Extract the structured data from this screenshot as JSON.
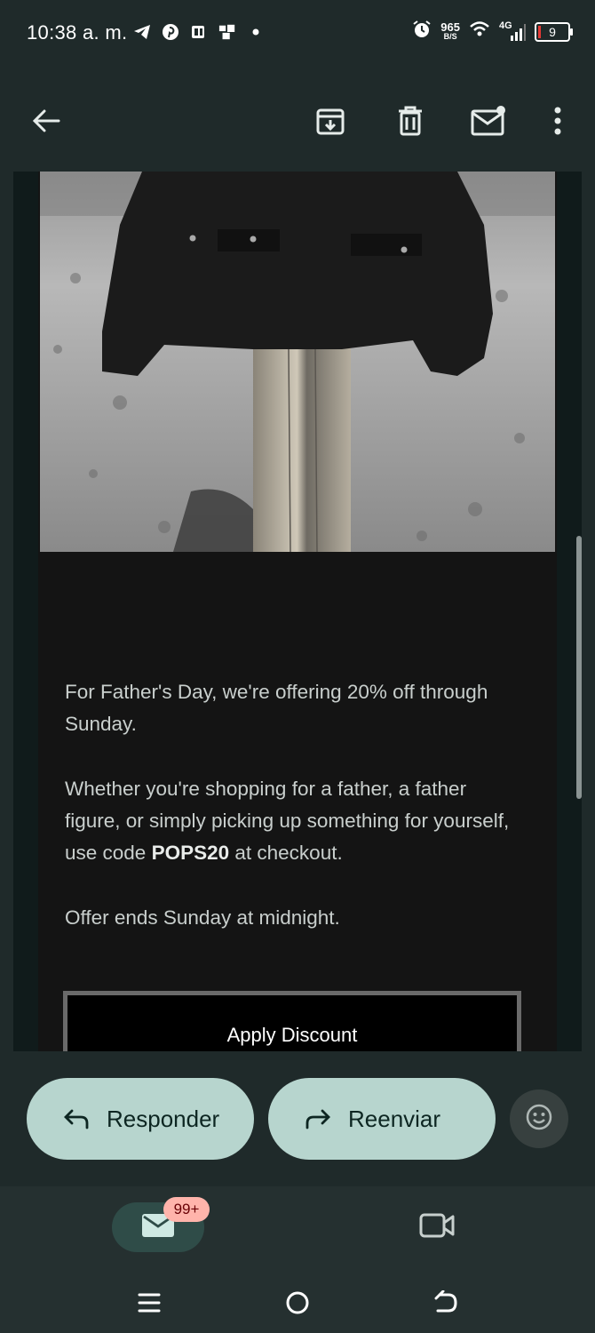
{
  "status_bar": {
    "time": "10:38 a. m.",
    "left_icons": [
      "telegram-icon",
      "pinterest-icon",
      "news-icon",
      "app-icon",
      "dot-icon"
    ],
    "net_speed_value": "965",
    "net_speed_unit": "B/S",
    "network": "4G",
    "battery": "9"
  },
  "toolbar": {
    "back": "arrow-back-icon",
    "actions": [
      "archive-icon",
      "delete-icon",
      "mark-unread-icon",
      "more-vert-icon"
    ]
  },
  "email": {
    "paragraph1": "For Father's Day, we're offering 20% off through Sunday.",
    "paragraph2_before": "Whether you're shopping for a father, a father figure, or simply picking up something for yourself, use code ",
    "paragraph2_code": "POPS20",
    "paragraph2_after": " at checkout.",
    "paragraph3": "Offer ends Sunday at midnight.",
    "cta_label": "Apply Discount"
  },
  "actions": {
    "reply_label": "Responder",
    "forward_label": "Reenviar"
  },
  "bottom_nav": {
    "mail_badge": "99+"
  },
  "colors": {
    "background": "#1f2a2a",
    "pill": "#b7d5ce",
    "badge": "#ffb4ab"
  }
}
